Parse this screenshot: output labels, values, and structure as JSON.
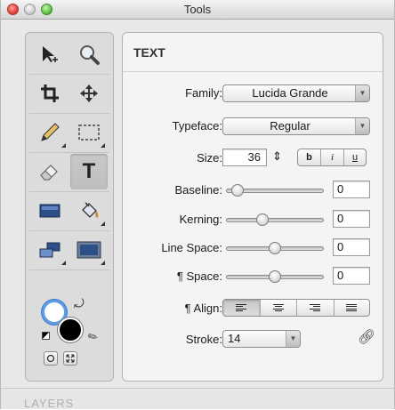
{
  "window": {
    "title": "Tools"
  },
  "tools": [
    {
      "name": "move-tool",
      "icon": "cursor-plus-icon"
    },
    {
      "name": "zoom-tool",
      "icon": "magnifier-icon"
    },
    {
      "name": "crop-tool",
      "icon": "crop-icon"
    },
    {
      "name": "pan-tool",
      "icon": "move-arrows-icon"
    },
    {
      "name": "pencil-tool",
      "icon": "pencil-icon"
    },
    {
      "name": "selection-tool",
      "icon": "marquee-icon"
    },
    {
      "name": "eraser-tool",
      "icon": "eraser-icon"
    },
    {
      "name": "text-tool",
      "icon": "text-t-icon",
      "active": true
    },
    {
      "name": "shape-tool",
      "icon": "rectangle-icon"
    },
    {
      "name": "fill-tool",
      "icon": "paint-bucket-icon"
    },
    {
      "name": "clone-tool",
      "icon": "clone-icon"
    },
    {
      "name": "effects-tool",
      "icon": "image-frame-icon"
    }
  ],
  "colors": {
    "stroke_ring": "#5d9ce6",
    "foreground": "#000000",
    "background": "#ffffff"
  },
  "text_panel": {
    "title": "TEXT",
    "family_label": "Family:",
    "family_value": "Lucida Grande",
    "typeface_label": "Typeface:",
    "typeface_value": "Regular",
    "size_label": "Size:",
    "size_value": "36",
    "size_stepper": "⇕",
    "bold_label": "b",
    "italic_label": "i",
    "underline_label": "u",
    "baseline_label": "Baseline:",
    "baseline_value": "0",
    "kerning_label": "Kerning:",
    "kerning_value": "0",
    "linespace_label": "Line Space:",
    "linespace_value": "0",
    "paraspace_label": "¶ Space:",
    "paraspace_value": "0",
    "align_label": "¶ Align:",
    "stroke_label": "Stroke:",
    "stroke_value": "14"
  },
  "slider_levels": {
    "baseline": 0.05,
    "kerning": 0.35,
    "linespace": 0.5,
    "paraspace": 0.5
  },
  "layers": {
    "label": "LAYERS"
  }
}
